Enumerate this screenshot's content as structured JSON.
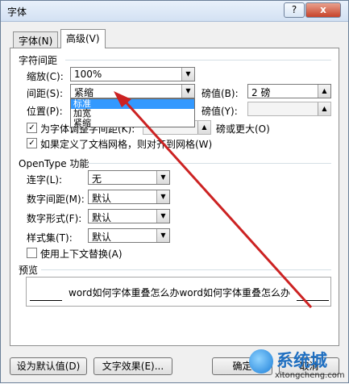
{
  "dialog": {
    "title": "字体",
    "help": "?",
    "close": "x"
  },
  "tabs": [
    {
      "label": "字体(N)"
    },
    {
      "label": "高级(V)"
    }
  ],
  "char_spacing": {
    "group_title": "字符间距",
    "scale_label": "缩放(C):",
    "scale_value": "100%",
    "spacing_label": "间距(S):",
    "spacing_value": "紧缩",
    "spacing_options": [
      "标准",
      "加宽",
      "紧缩"
    ],
    "spacing_selected": "标准",
    "pound_label_1": "磅值(B):",
    "pound_value_1": "2 磅",
    "position_label": "位置(P):",
    "pound_label_2": "磅值(Y):",
    "kerning_label": "为字体调整字间距(K):",
    "kerning_suffix": "磅或更大(O)",
    "grid_label": "如果定义了文档网格，则对齐到网格(W)"
  },
  "opentype": {
    "group_title": "OpenType 功能",
    "ligature_label": "连字(L):",
    "ligature_value": "无",
    "num_spacing_label": "数字间距(M):",
    "num_spacing_value": "默认",
    "num_form_label": "数字形式(F):",
    "num_form_value": "默认",
    "style_set_label": "样式集(T):",
    "style_set_value": "默认",
    "contextual_label": "使用上下文替换(A)"
  },
  "preview": {
    "title": "预览",
    "text": "word如何字体重叠怎么办word如何字体重叠怎么办"
  },
  "buttons": {
    "set_default": "设为默认值(D)",
    "text_effects": "文字效果(E)...",
    "ok": "确定",
    "cancel": "取消"
  },
  "watermark": {
    "name": "系统城",
    "url": "xitongcheng.com"
  },
  "colors": {
    "arrow": "#cc2222",
    "selection": "#3399ff"
  }
}
